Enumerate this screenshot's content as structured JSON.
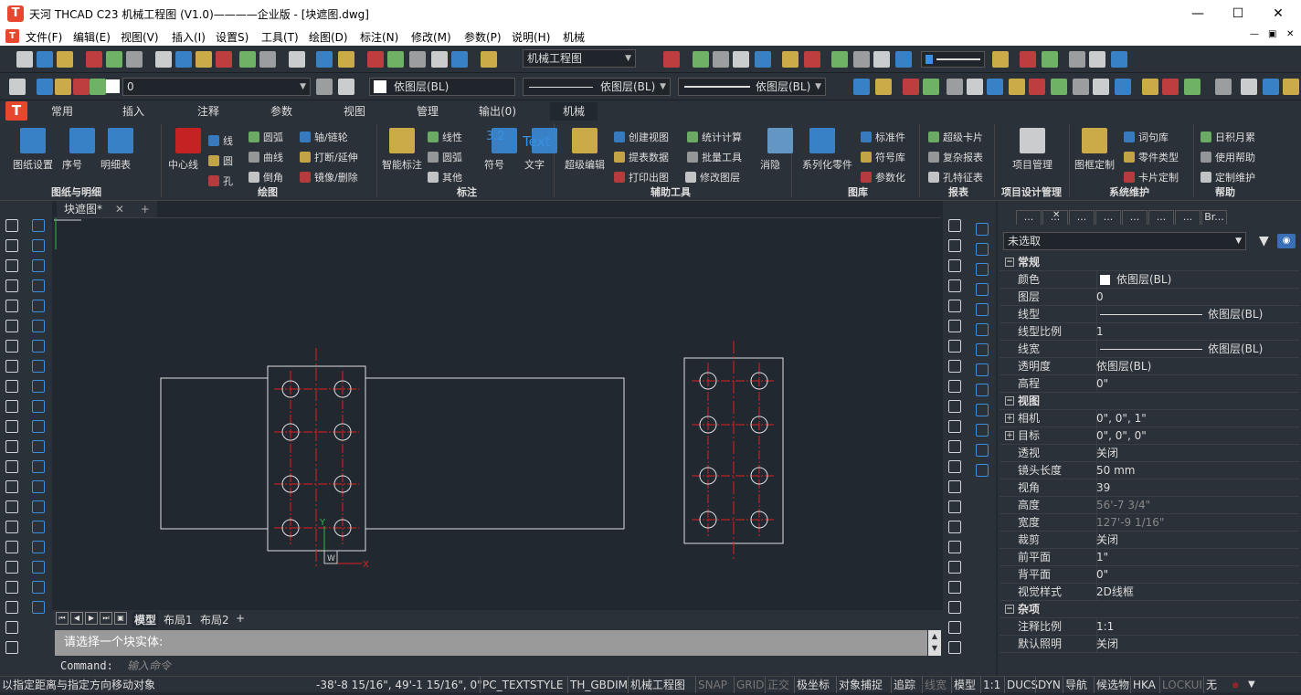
{
  "title_bar": {
    "title": "天河 THCAD C23 机械工程图 (V1.0)————企业版 - [块遮图.dwg]",
    "logo": "T",
    "controls": [
      "minimize",
      "maximize",
      "close"
    ]
  },
  "menu": [
    "文件(F)",
    "编辑(E)",
    "视图(V)",
    "插入(I)",
    "设置S)",
    "工具(T)",
    "绘图(D)",
    "标注(N)",
    "修改(M)",
    "参数(P)",
    "说明(H)",
    "机械"
  ],
  "toolbar1": {
    "workspace": "机械工程图"
  },
  "toolbar2": {
    "layer": "0",
    "color": "依图层(BL)",
    "linetype": "依图层(BL)",
    "lineweight": "依图层(BL)"
  },
  "ribbon_tabs": [
    "常用",
    "插入",
    "注释",
    "参数",
    "视图",
    "管理",
    "输出(0)",
    "机械"
  ],
  "ribbon_active": "机械",
  "ribbon": {
    "groups": [
      "图纸与明细",
      "绘图",
      "标注",
      "辅助工具",
      "图库",
      "报表",
      "项目设计管理",
      "系统维护",
      "帮助"
    ],
    "big": {
      "tuzhi": "图纸设置",
      "xuhao": "序号",
      "mingxi": "明细表",
      "zhongxin": "中心线",
      "zhineng": "智能标注",
      "fuhao": "符号",
      "wenzi": "文字",
      "text": "Text",
      "chaoji": "超级编辑",
      "xiaoyin": "消隐",
      "xilie": "系列化零件",
      "xiangmu": "项目管理",
      "tujia": "图框定制",
      "sym32": "3.2"
    },
    "small": [
      "线",
      "圆",
      "孔",
      "圆弧",
      "曲线",
      "倒角",
      "轴/链轮",
      "打断/延伸",
      "镜像/删除",
      "线性",
      "圆弧",
      "其他",
      "创建视图",
      "提表数据",
      "打印出图",
      "统计计算",
      "批量工具",
      "修改图层",
      "标准件",
      "符号库",
      "参数化",
      "超级卡片",
      "复杂报表",
      "孔特征表",
      "词句库",
      "零件类型",
      "卡片定制",
      "日积月累",
      "使用帮助",
      "定制维护"
    ]
  },
  "document": {
    "tab": "块遮图*",
    "plus": "+"
  },
  "layout_tabs": [
    "模型",
    "布局1",
    "布局2",
    "+"
  ],
  "command": {
    "history": "请选择一个块实体:",
    "label": "Command:",
    "placeholder": "输入命令"
  },
  "properties": {
    "tabs": [
      "...",
      "...",
      "...",
      "...",
      "...",
      "...",
      "...",
      "Br..."
    ],
    "selection": "未选取",
    "rows": [
      {
        "g": "常规"
      },
      {
        "k": "颜色",
        "v": "依图层(BL)",
        "swatch": true
      },
      {
        "k": "图层",
        "v": "0"
      },
      {
        "k": "线型",
        "v": "依图层(BL)",
        "line": true
      },
      {
        "k": "线型比例",
        "v": "1"
      },
      {
        "k": "线宽",
        "v": "依图层(BL)",
        "line": true
      },
      {
        "k": "透明度",
        "v": "依图层(BL)"
      },
      {
        "k": "高程",
        "v": "0\""
      },
      {
        "g": "视图"
      },
      {
        "k": "相机",
        "v": "0\", 0\", 1\"",
        "ex": true
      },
      {
        "k": "目标",
        "v": "0\", 0\", 0\"",
        "ex": true
      },
      {
        "k": "透视",
        "v": "关闭"
      },
      {
        "k": "镜头长度",
        "v": "50 mm"
      },
      {
        "k": "视角",
        "v": "39"
      },
      {
        "k": "高度",
        "v": "56'-7 3/4\"",
        "dim": true
      },
      {
        "k": "宽度",
        "v": "127'-9 1/16\"",
        "dim": true
      },
      {
        "k": "裁剪",
        "v": "关闭"
      },
      {
        "k": "前平面",
        "v": "1\""
      },
      {
        "k": "背平面",
        "v": "0\""
      },
      {
        "k": "视觉样式",
        "v": "2D线框"
      },
      {
        "g": "杂项"
      },
      {
        "k": "注释比例",
        "v": "1:1"
      },
      {
        "k": "默认照明",
        "v": "关闭"
      }
    ]
  },
  "status": {
    "prompt": "以指定距离与指定方向移动对象",
    "coords": "-38'-8 15/16\", 49'-1 15/16\", 0\"",
    "items": [
      {
        "t": "PC_TEXTSTYLE",
        "on": true
      },
      {
        "t": "TH_GBDIM",
        "on": true
      },
      {
        "t": "机械工程图",
        "on": true
      },
      {
        "t": "SNAP",
        "on": false
      },
      {
        "t": "GRID",
        "on": false
      },
      {
        "t": "正交",
        "on": false
      },
      {
        "t": "极坐标",
        "on": true
      },
      {
        "t": "对象捕捉",
        "on": true
      },
      {
        "t": "追踪",
        "on": true
      },
      {
        "t": "线宽",
        "on": false
      },
      {
        "t": "模型",
        "on": true
      },
      {
        "t": "1:1",
        "on": true
      },
      {
        "t": "DUCS",
        "on": true
      },
      {
        "t": "DYN",
        "on": true
      },
      {
        "t": "导航",
        "on": true
      },
      {
        "t": "候选物",
        "on": true
      },
      {
        "t": "HKA",
        "on": true
      },
      {
        "t": "LOCKUI",
        "on": false
      },
      {
        "t": "无",
        "on": true
      }
    ]
  },
  "colors": {
    "accent": "#e8472f",
    "bg": "#212830",
    "panel": "#2b3138",
    "red": "#e02020"
  }
}
